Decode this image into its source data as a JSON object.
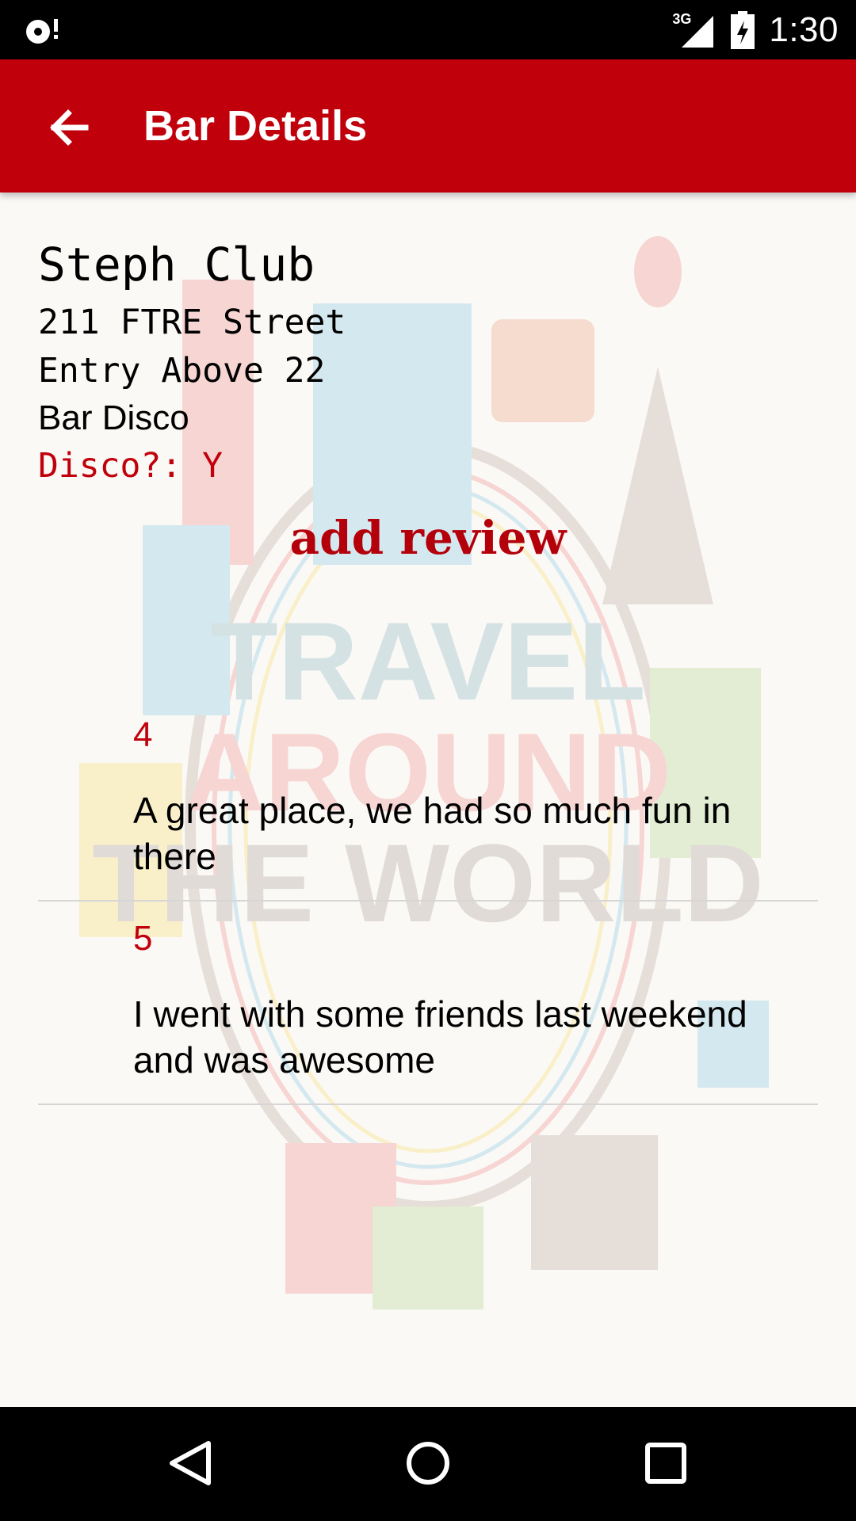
{
  "status_bar": {
    "network": "3G",
    "time": "1:30",
    "icons": [
      "cast-icon",
      "signal-icon",
      "battery-charging-icon"
    ]
  },
  "app_bar": {
    "title": "Bar Details",
    "back_icon": "arrow-back-icon"
  },
  "bar": {
    "name": "Steph Club",
    "address": "211 FTRE Street",
    "entry": "Entry Above 22",
    "type": "Bar Disco",
    "disco": "Disco?: Y"
  },
  "add_review_label": "add review",
  "reviews": [
    {
      "rating": "4",
      "text": "A great place, we had so much fun in there"
    },
    {
      "rating": "5",
      "text": "I went with some friends last weekend and was awesome"
    }
  ],
  "watermark": {
    "line1": "TRAVEL",
    "line2": "AROUND",
    "line3": "THE WORLD"
  },
  "nav_bar": {
    "icons": [
      "back-triangle-icon",
      "home-circle-icon",
      "recents-square-icon"
    ]
  },
  "colors": {
    "primary": "#c0000b",
    "accent_text": "#c0000b"
  }
}
